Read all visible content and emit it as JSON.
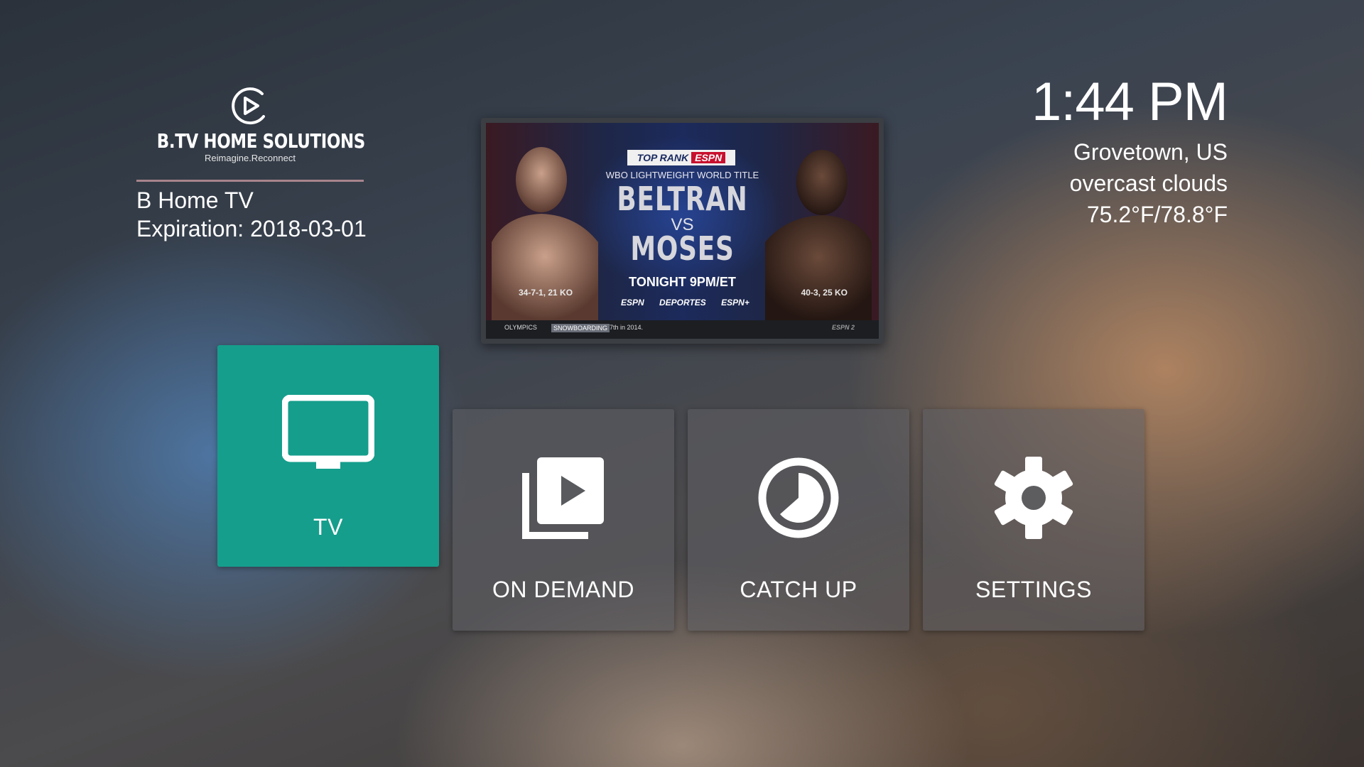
{
  "brand": {
    "name": "B.TV  HOME  SOLUTIONS",
    "tagline": "Reimagine.Reconnect",
    "logo_icon": "play-circle-icon"
  },
  "account": {
    "service": "B Home TV",
    "expiration": "Expiration: 2018-03-01"
  },
  "status": {
    "time": "1:44 PM",
    "location": "Grovetown, US",
    "condition": "overcast clouds",
    "temperature": "75.2°F/78.8°F"
  },
  "preview": {
    "badge_main": "TOP RANK",
    "badge_network": "ESPN",
    "subtitle": "WBO LIGHTWEIGHT WORLD TITLE",
    "fighter_1": "BELTRAN",
    "vs": "VS",
    "fighter_2": "MOSES",
    "tonight": "TONIGHT 9PM/ET",
    "record_left": "34-7-1, 21 KO",
    "record_right": "40-3, 25 KO",
    "networks": "ESPN DEPORTES ESPN+",
    "ticker_category": "OLYMPICS",
    "ticker_tag": "SNOWBOARDING",
    "ticker_text": "7th in 2014.",
    "ticker_channel": "ESPN 2"
  },
  "menu": {
    "tiles": [
      {
        "label": "TV",
        "icon": "tv-icon",
        "selected": true
      },
      {
        "label": "ON DEMAND",
        "icon": "video-library-icon",
        "selected": false
      },
      {
        "label": "CATCH UP",
        "icon": "clock-icon",
        "selected": false
      },
      {
        "label": "SETTINGS",
        "icon": "gear-icon",
        "selected": false
      }
    ]
  },
  "colors": {
    "accent": "#159e8c",
    "tile_bg": "#5f5f64",
    "rule": "#a8848c"
  }
}
